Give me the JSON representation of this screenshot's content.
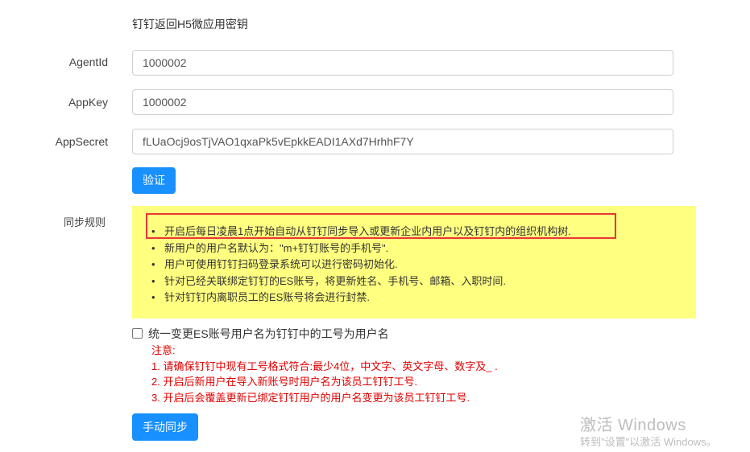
{
  "section_title": "钉钉返回H5微应用密钥",
  "form": {
    "agentid_label": "AgentId",
    "agentid_value": "1000002",
    "appkey_label": "AppKey",
    "appkey_value": "1000002",
    "appsecret_label": "AppSecret",
    "appsecret_value": "fLUaOcj9osTjVAO1qxaPk5vEpkkEADI1AXd7HrhhF7Y",
    "verify_button": "验证"
  },
  "sync_rules": {
    "label": "同步规则",
    "items": [
      "开启后每日凌晨1点开始自动从钉钉同步导入或更新企业内用户以及钉钉内的组织机构树.",
      "新用户的用户名默认为：\"m+钉钉账号的手机号\".",
      "用户可使用钉钉扫码登录系统可以进行密码初始化.",
      "针对已经关联绑定钉钉的ES账号，将更新姓名、手机号、邮箱、入职时间.",
      "针对钉钉内离职员工的ES账号将会进行封禁."
    ],
    "highlight_color": "#e53935",
    "box_color": "#ffff80"
  },
  "checkbox": {
    "label": "统一变更ES账号用户名为钉钉中的工号为用户名",
    "checked": false
  },
  "notes": {
    "title": "注意:",
    "items": [
      "1. 请确保钉钉中现有工号格式符合:最少4位，中文字、英文字母、数字及_ .",
      "2. 开启后新用户在导入新账号时用户名为该员工钉钉工号.",
      "3. 开启后会覆盖更新已绑定钉钉用户的用户名变更为该员工钉钉工号."
    ],
    "color": "#e00000"
  },
  "manual_sync_button": "手动同步",
  "accent_color": "#1890ff",
  "watermark": {
    "line1": "激活 Windows",
    "line2": "转到\"设置\"以激活 Windows。"
  }
}
